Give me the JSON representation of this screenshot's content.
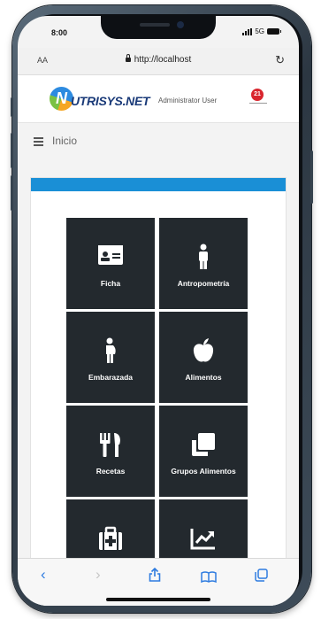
{
  "status_bar": {
    "time": "8:00",
    "network": "5G"
  },
  "browser": {
    "text_size_label": "AA",
    "url": "http://localhost",
    "reload_icon": "reload-icon"
  },
  "header": {
    "logo_letter": "N",
    "logo_text": "UTRISYS.NET",
    "user_name": "Administrator User",
    "notifications_count": "21"
  },
  "breadcrumb": {
    "label": "Inicio"
  },
  "card": {
    "accent_color": "#1a8fd6"
  },
  "tiles": [
    {
      "label": "Ficha",
      "icon": "id-card-icon"
    },
    {
      "label": "Antropometría",
      "icon": "person-icon"
    },
    {
      "label": "Embarazada",
      "icon": "pregnant-icon"
    },
    {
      "label": "Alimentos",
      "icon": "apple-icon"
    },
    {
      "label": "Recetas",
      "icon": "utensils-icon"
    },
    {
      "label": "Grupos Alimentos",
      "icon": "clone-icon"
    },
    {
      "label": "",
      "icon": "medkit-icon"
    },
    {
      "label": "",
      "icon": "chart-line-icon"
    }
  ],
  "colors": {
    "tile_bg": "#23292e",
    "brand_blue": "#1a3a78",
    "badge_red": "#d9262e",
    "safari_blue": "#2f7ce0"
  },
  "toolbar": {
    "back_icon": "back-icon",
    "forward_icon": "forward-icon",
    "share_icon": "share-icon",
    "bookmarks_icon": "bookmarks-icon",
    "tabs_icon": "tabs-icon"
  }
}
